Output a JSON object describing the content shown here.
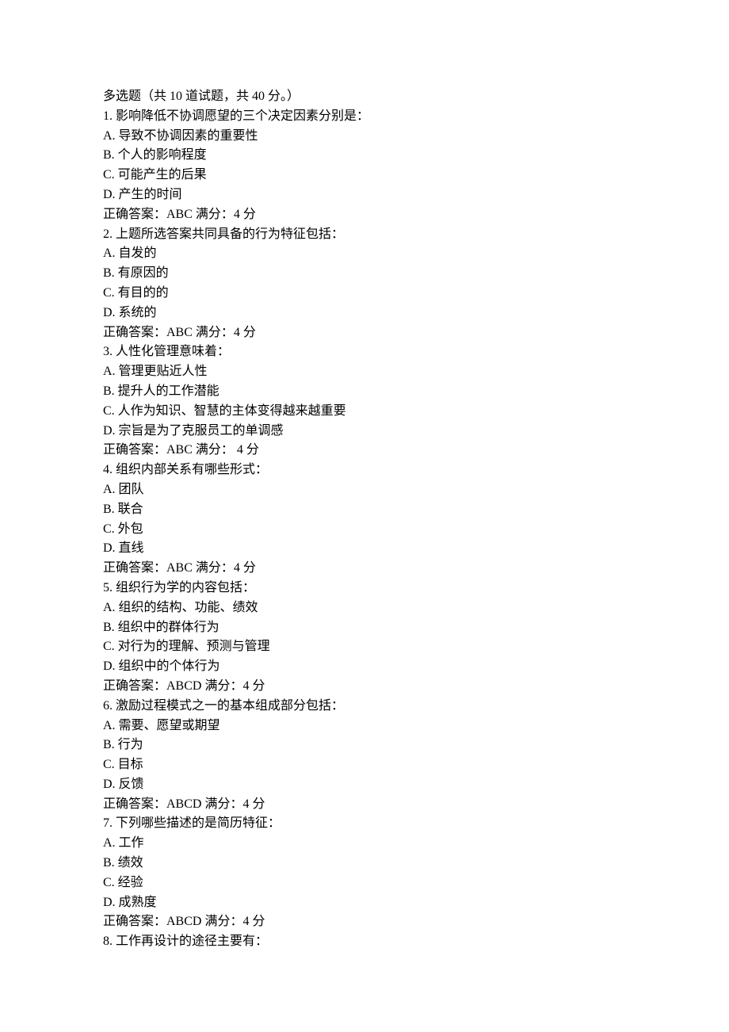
{
  "header": "多选题（共 10 道试题，共 40 分。）",
  "questions": [
    {
      "num": "1.",
      "stem": "影响降低不协调愿望的三个决定因素分别是：",
      "options": [
        "A. 导致不协调因素的重要性",
        "B. 个人的影响程度",
        "C. 可能产生的后果",
        "D. 产生的时间"
      ],
      "answer": "正确答案：ABC 满分：4 分"
    },
    {
      "num": "2.",
      "stem": "上题所选答案共同具备的行为特征包括：",
      "options": [
        "A. 自发的",
        "B. 有原因的",
        "C. 有目的的",
        "D. 系统的"
      ],
      "answer": "正确答案：ABC 满分：4 分"
    },
    {
      "num": "3.",
      "stem": "人性化管理意味着：",
      "options": [
        "A. 管理更贴近人性",
        "B. 提升人的工作潜能",
        "C. 人作为知识、智慧的主体变得越来越重要",
        "D. 宗旨是为了克服员工的单调感"
      ],
      "answer": "正确答案：ABC 满分： 4 分"
    },
    {
      "num": "4.",
      "stem": "组织内部关系有哪些形式：",
      "options": [
        "A. 团队",
        "B. 联合",
        "C. 外包",
        "D. 直线"
      ],
      "answer": "正确答案：ABC 满分：4 分"
    },
    {
      "num": "5.",
      "stem": "组织行为学的内容包括：",
      "options": [
        "A. 组织的结构、功能、绩效",
        "B. 组织中的群体行为",
        "C. 对行为的理解、预测与管理",
        "D. 组织中的个体行为"
      ],
      "answer": "正确答案：ABCD 满分：4 分"
    },
    {
      "num": "6.",
      "stem": "激励过程模式之一的基本组成部分包括：",
      "options": [
        "A. 需要、愿望或期望",
        "B. 行为",
        "C. 目标",
        "D. 反馈"
      ],
      "answer": "正确答案：ABCD 满分：4 分"
    },
    {
      "num": "7.",
      "stem": "下列哪些描述的是简历特征：",
      "options": [
        "A. 工作",
        "B. 绩效",
        "C. 经验",
        "D. 成熟度"
      ],
      "answer": "正确答案：ABCD 满分：4 分"
    },
    {
      "num": "8.",
      "stem": "工作再设计的途径主要有：",
      "options": [],
      "answer": ""
    }
  ]
}
